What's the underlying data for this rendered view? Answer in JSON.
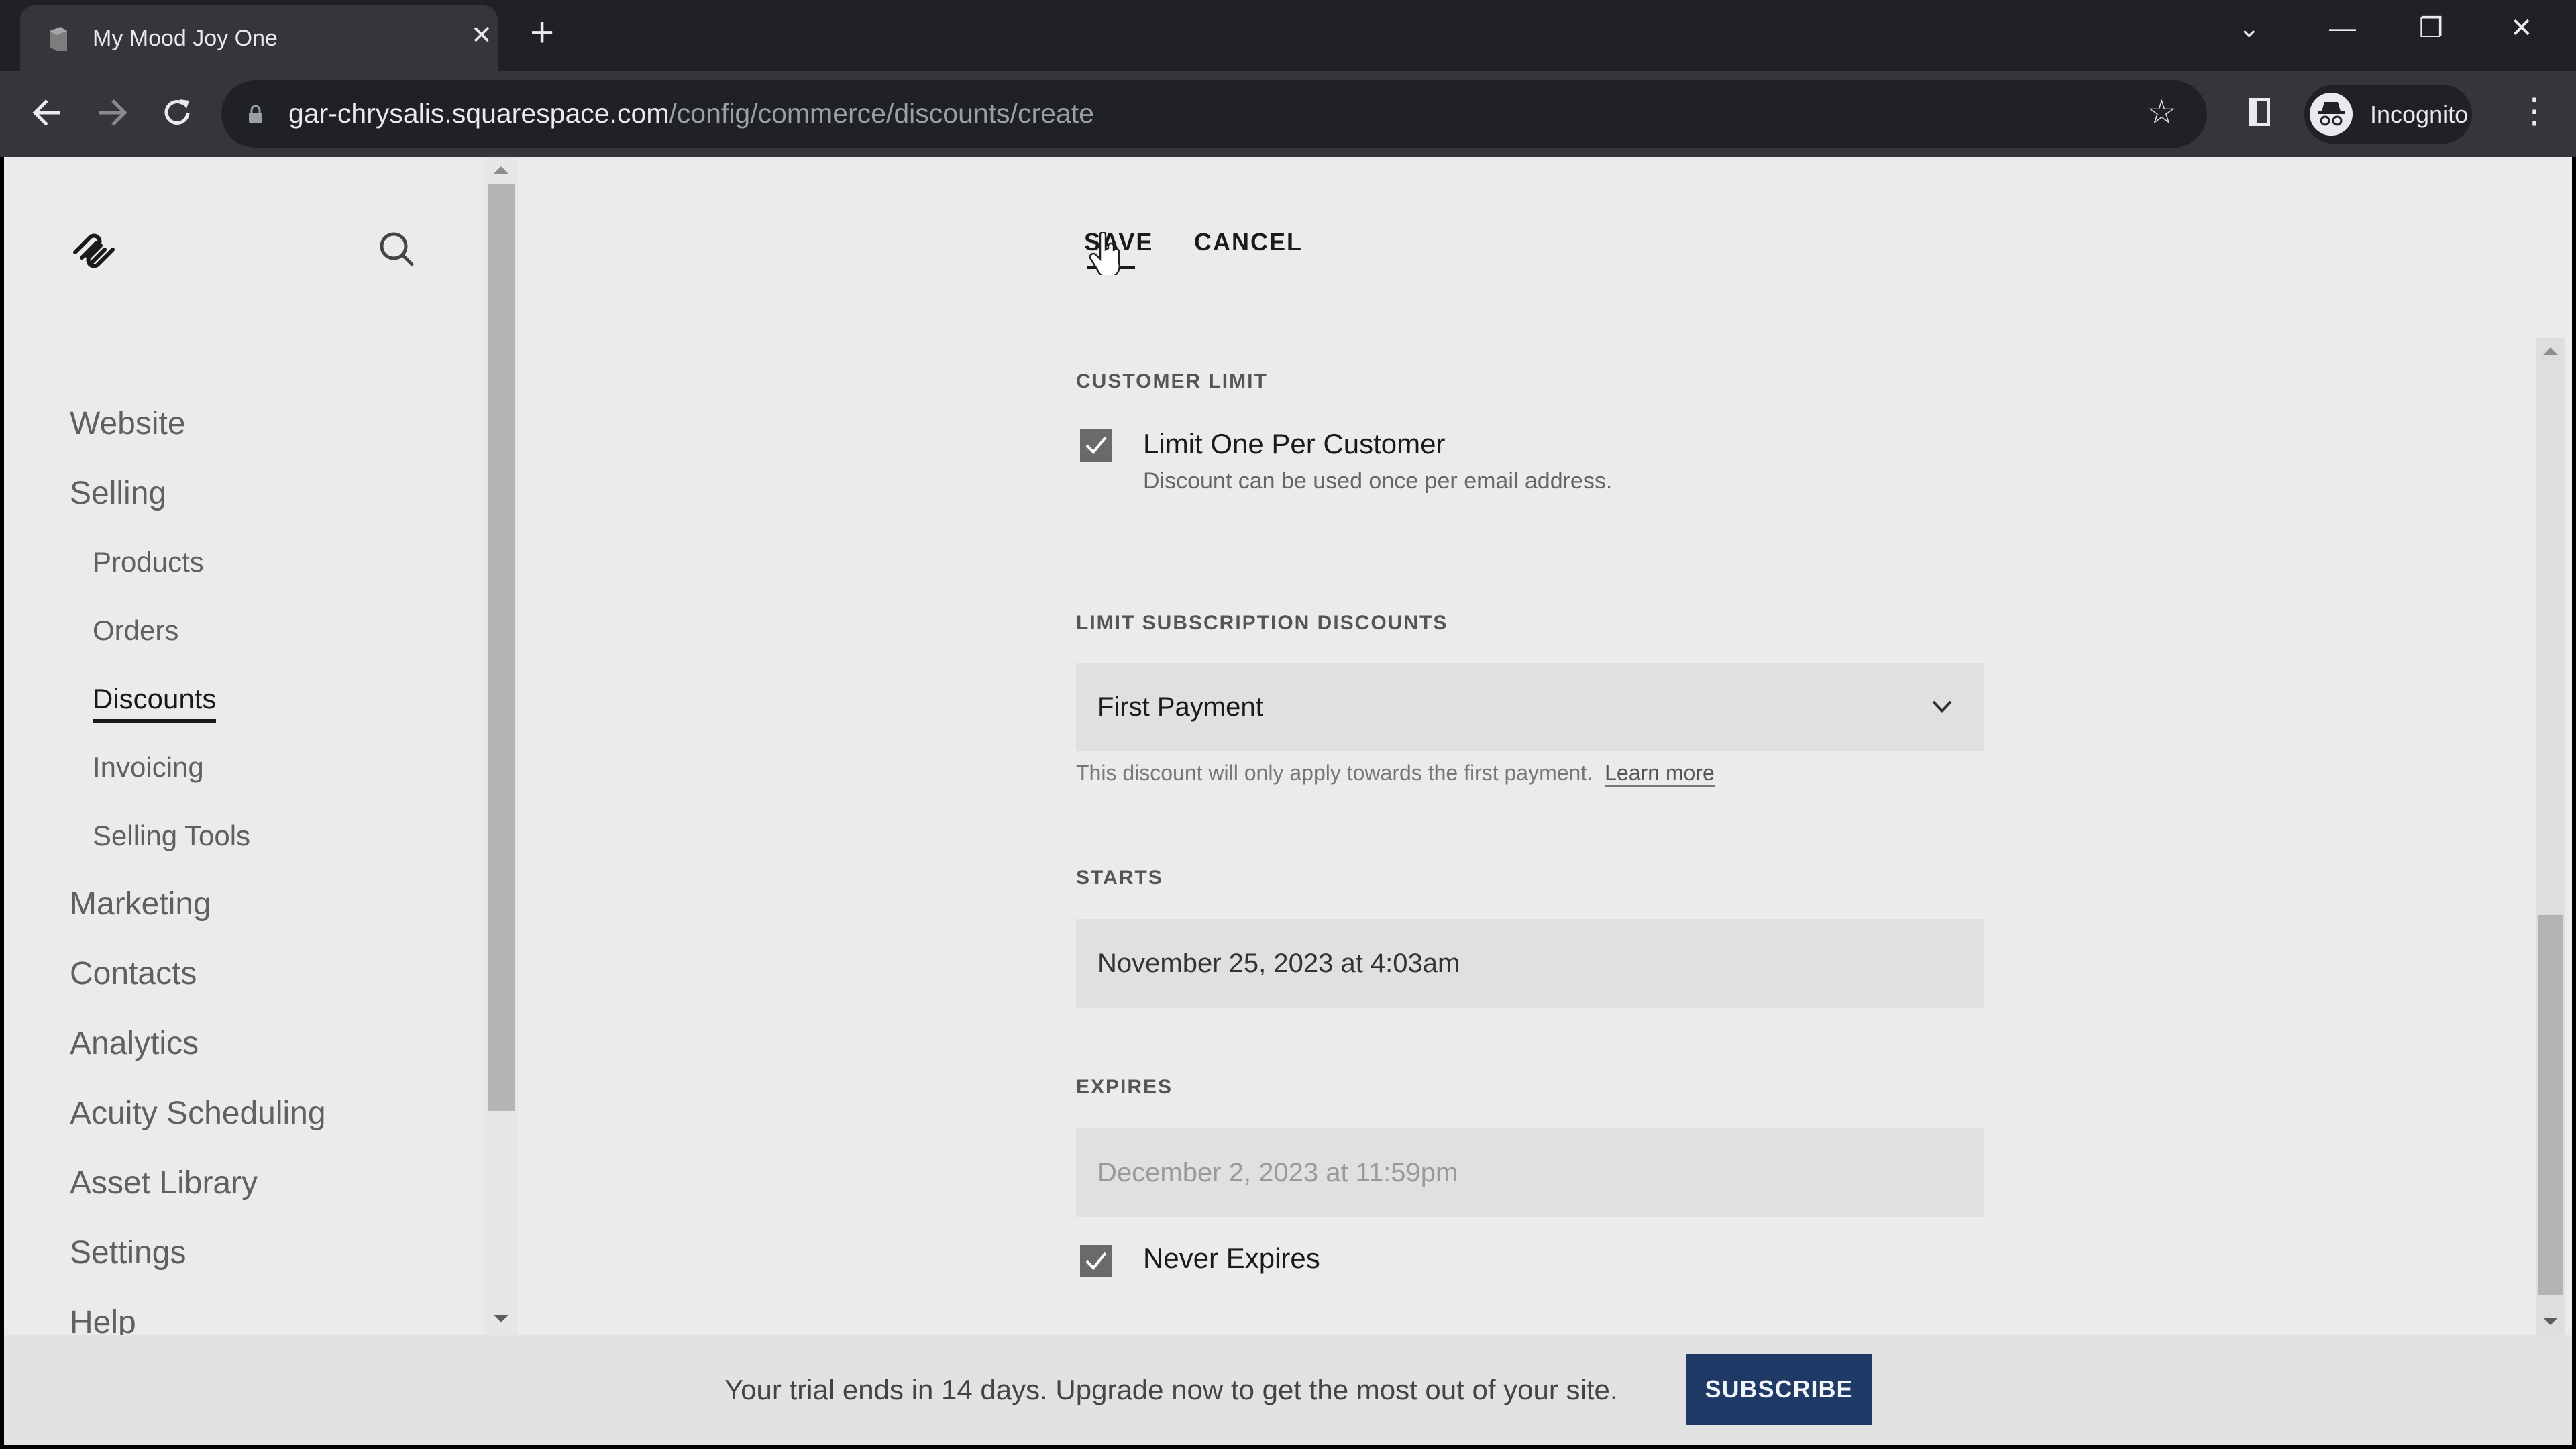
{
  "browser": {
    "tab_title": "My Mood Joy One",
    "tab_close_glyph": "✕",
    "new_tab_glyph": "+",
    "url_host": "gar-chrysalis.squarespace.com",
    "url_path": "/config/commerce/discounts/create",
    "profile_label": "Incognito",
    "icons": {
      "back": "back-arrow-icon",
      "forward": "forward-arrow-icon",
      "reload": "reload-icon",
      "lock": "lock-icon",
      "bookmark": "star-icon",
      "side_panel": "side-panel-icon",
      "profile": "incognito-icon",
      "menu": "kebab-menu-icon"
    },
    "window_controls": {
      "tab_search": "⌄",
      "minimize": "—",
      "restore": "❐",
      "close": "✕"
    }
  },
  "sidebar": {
    "items": [
      {
        "label": "Website",
        "level": "top",
        "active": false
      },
      {
        "label": "Selling",
        "level": "top",
        "active": false
      },
      {
        "label": "Products",
        "level": "sub",
        "active": false
      },
      {
        "label": "Orders",
        "level": "sub",
        "active": false
      },
      {
        "label": "Discounts",
        "level": "sub",
        "active": true
      },
      {
        "label": "Invoicing",
        "level": "sub",
        "active": false
      },
      {
        "label": "Selling Tools",
        "level": "sub",
        "active": false
      },
      {
        "label": "Marketing",
        "level": "top",
        "active": false
      },
      {
        "label": "Contacts",
        "level": "top",
        "active": false
      },
      {
        "label": "Analytics",
        "level": "top",
        "active": false
      },
      {
        "label": "Acuity Scheduling",
        "level": "top",
        "active": false
      },
      {
        "label": "Asset Library",
        "level": "top",
        "active": false
      },
      {
        "label": "Settings",
        "level": "top",
        "active": false
      },
      {
        "label": "Help",
        "level": "top",
        "active": false
      }
    ]
  },
  "actions": {
    "save_label": "SAVE",
    "cancel_label": "CANCEL"
  },
  "form": {
    "customer_limit": {
      "section_label": "CUSTOMER LIMIT",
      "checkbox_label": "Limit One Per Customer",
      "checked": true,
      "description": "Discount can be used once per email address."
    },
    "subscription": {
      "section_label": "LIMIT SUBSCRIPTION DISCOUNTS",
      "selected_value": "First Payment",
      "help_text": "This discount will only apply towards the first payment.",
      "help_link": "Learn more"
    },
    "starts": {
      "section_label": "STARTS",
      "value": "November 25, 2023 at 4:03am"
    },
    "expires": {
      "section_label": "EXPIRES",
      "value": "December 2, 2023 at 11:59pm",
      "never_expires_label": "Never Expires",
      "never_expires_checked": true
    }
  },
  "banner": {
    "text": "Your trial ends in 14 days. Upgrade now to get the most out of your site.",
    "button_label": "SUBSCRIBE",
    "button_color": "#1f3a66"
  }
}
